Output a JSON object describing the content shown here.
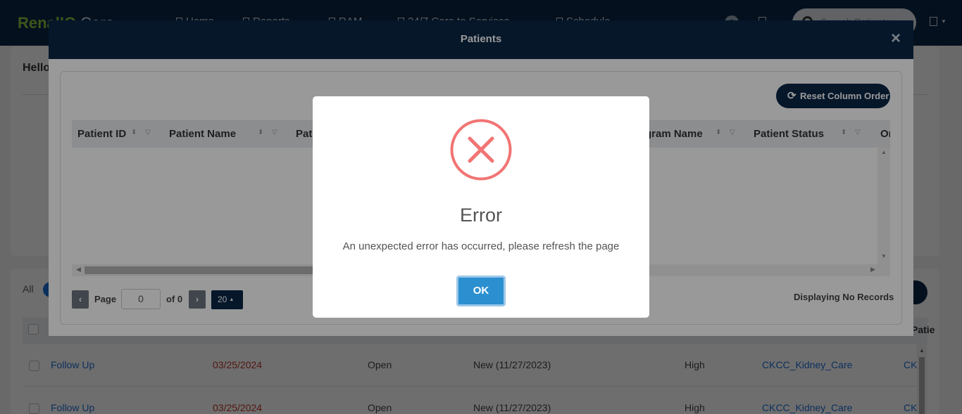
{
  "app": {
    "brand_part1": "RenalIQ",
    "brand_part2": "Care",
    "nav": [
      "Home",
      "Reports",
      "RAM",
      "24/7 Care to Services",
      "Schedule"
    ],
    "search_placeholder": "Search Patients",
    "greeting": "Hello",
    "tabs": {
      "all": "All"
    },
    "table_partial_header": "Patie",
    "rows": [
      {
        "task": "Follow Up",
        "due": "03/25/2024",
        "status": "Open",
        "type": "New (11/27/2023)",
        "priority": "High",
        "program": "CKCC_Kidney_Care",
        "extra": "CK"
      },
      {
        "task": "Follow Up",
        "due": "03/25/2024",
        "status": "Open",
        "type": "New (11/27/2023)",
        "priority": "High",
        "program": "CKCC_Kidney_Care",
        "extra": "CK"
      }
    ]
  },
  "patients_modal": {
    "title": "Patients",
    "close": "×",
    "reset_button": "Reset Column Order",
    "columns": [
      "Patient ID",
      "Patient Name",
      "Pat",
      "gram Name",
      "Patient Status",
      "Or"
    ],
    "pager": {
      "page_label": "Page",
      "page_value": "0",
      "of_label": "of 0",
      "page_size": "20",
      "display_text": "Displaying No Records"
    }
  },
  "error_dialog": {
    "title": "Error",
    "message": "An unexpected error has occurred, please refresh the page",
    "ok_label": "OK",
    "icon_color": "#f27474",
    "ok_color": "#2b8fd0"
  }
}
